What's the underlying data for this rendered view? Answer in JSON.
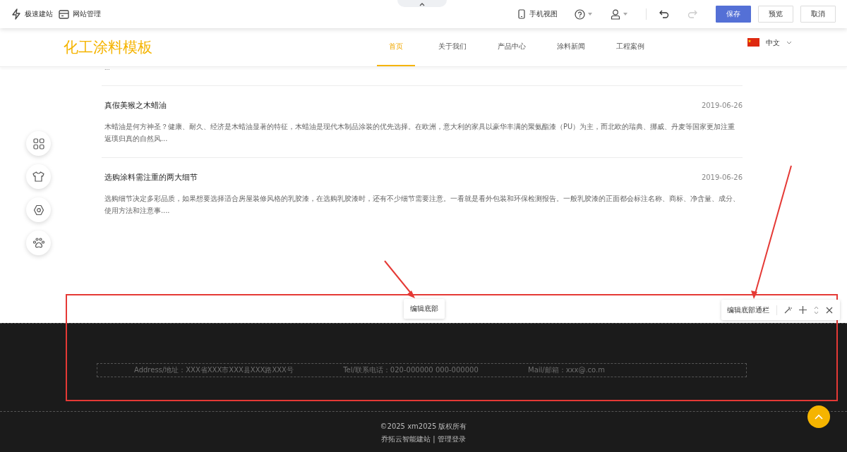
{
  "toolbar": {
    "left": [
      {
        "kind": "bolt",
        "label": "极速建站"
      },
      {
        "kind": "card",
        "label": "网站管理"
      }
    ],
    "mobile_view": "手机视图",
    "redo": {
      "disabled": true
    },
    "buttons": [
      {
        "label": "保存",
        "kind": "primary"
      },
      {
        "label": "预览",
        "kind": "default"
      },
      {
        "label": "取消",
        "kind": "default"
      }
    ]
  },
  "site": {
    "logo": "化工涂料模板",
    "nav": [
      {
        "label": "首页",
        "selected": true
      },
      {
        "label": "关于我们",
        "selected": false
      },
      {
        "label": "产品中心",
        "selected": false
      },
      {
        "label": "涂料新闻",
        "selected": false
      },
      {
        "label": "工程案例",
        "selected": false
      }
    ],
    "language": "中文"
  },
  "cut_text": "...",
  "articles": [
    {
      "title": "真假美猴之木蜡油",
      "date": "2019-06-26",
      "summary": "木蜡油是何方神圣？健康、耐久、经济是木蜡油显著的特征，木蜡油是现代木制品涂装的优先选择。在欧洲，意大利的家具以豪华丰满的聚氨酯漆（PU）为主，而北欧的瑞典、挪威、丹麦等国家更加注重返璞归真的自然风..."
    },
    {
      "title": "选购涂料需注重的两大细节",
      "date": "2019-06-26",
      "summary": "选购细节决定多彩品质，如果想要选择适合房屋装修风格的乳胶漆，在选购乳胶漆时，还有不少细节需要注意。一看就是看外包装和环保检测报告。一般乳胶漆的正面都会标注名称、商标、净含量、成分、使用方法和注意事...."
    }
  ],
  "editor": {
    "footer_label": "编辑底部",
    "bar_label": "编辑底部通栏"
  },
  "footer": {
    "contacts": [
      "Address/地址：XXX省XXX市XXX县XXX路XXX号",
      "Tel/联系电话：020-000000 000-000000",
      "Mail/邮箱：xxx@.co.m"
    ],
    "copyright": "©2025 xm2025 版权所有",
    "links": [
      "乔拓云智能建站",
      "管理登录"
    ],
    "separator": "|"
  }
}
